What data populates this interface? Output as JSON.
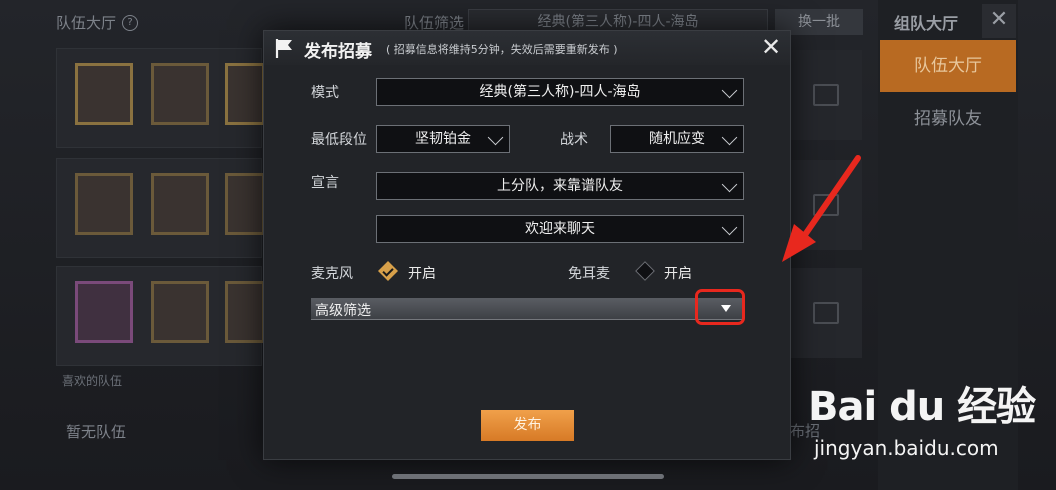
{
  "lobby": {
    "title": "队伍大厅",
    "help_icon": "?",
    "filter_label": "队伍筛选",
    "filter_value": "经典(第三人称)-四人-海岛",
    "refresh_label": "换一批",
    "favor_teams_label": "喜欢的队伍",
    "no_team_label": "暂无队伍",
    "publish_side_label": "布招"
  },
  "side_panel": {
    "title": "组队大厅",
    "close_glyph": "✕",
    "tab_active": "队伍大厅",
    "tab_recruit": "招募队友"
  },
  "dialog": {
    "title": "发布招募",
    "note": "( 招募信息将维持5分钟，失效后需要重新发布 )",
    "close_glyph": "✕",
    "mode_label": "模式",
    "mode_value": "经典(第三人称)-四人-海岛",
    "min_rank_label": "最低段位",
    "min_rank_value": "坚韧铂金",
    "tactic_label": "战术",
    "tactic_value": "随机应变",
    "declaration_label": "宣言",
    "declaration_value_1": "上分队，来靠谱队友",
    "declaration_value_2": "欢迎来聊天",
    "mic_label": "麦克风",
    "mic_option": "开启",
    "mic_checked": true,
    "speaker_label": "免耳麦",
    "speaker_option": "开启",
    "speaker_checked": false,
    "advanced_filter_label": "高级筛选",
    "publish_label": "发布"
  },
  "colors": {
    "accent_orange": "#e08a30",
    "annotation_red": "#e8281e",
    "check_gold": "#d7a04a"
  },
  "watermark": {
    "logo": "Bai du 经验",
    "url": "jingyan.baidu.com"
  }
}
